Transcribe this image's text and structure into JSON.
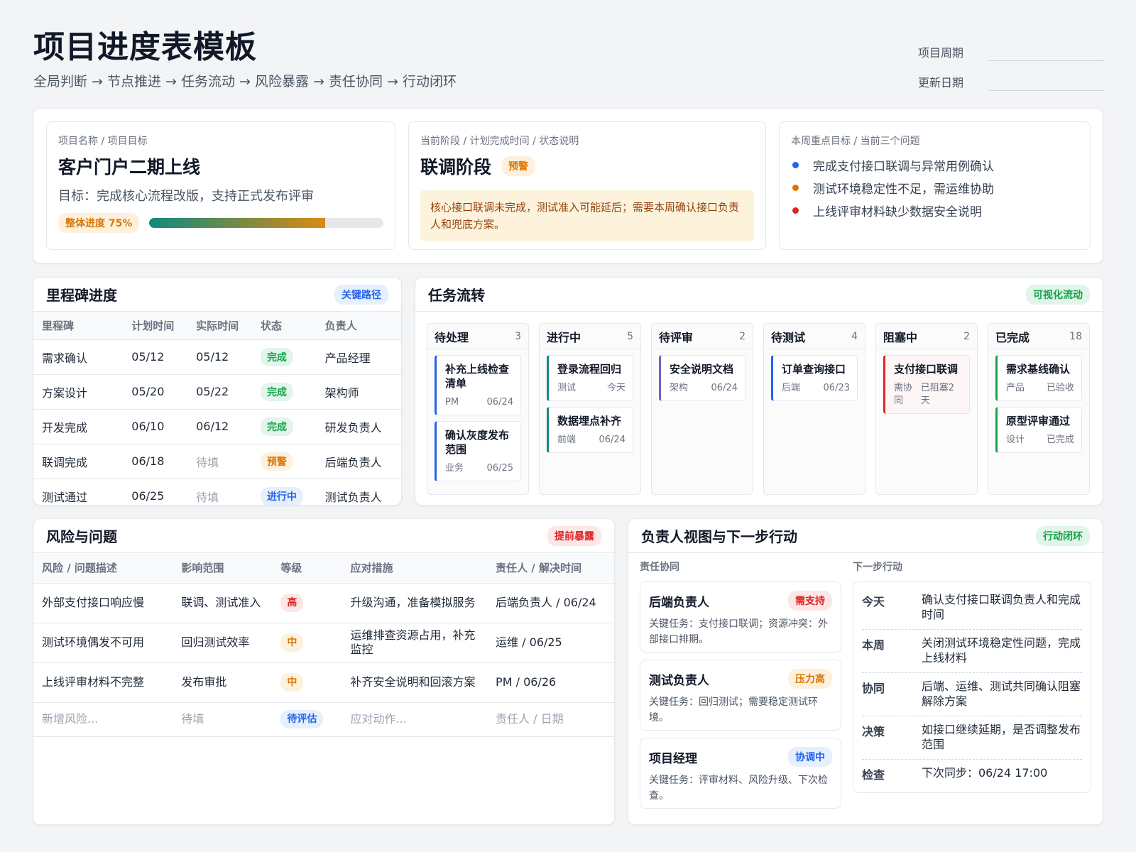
{
  "header": {
    "title": "项目进度表模板",
    "subtitle": "全局判断 → 节点推进 → 任务流动 → 风险暴露 → 责任协同 → 行动闭环",
    "cycle_label": "项目周期",
    "update_label": "更新日期"
  },
  "overview": {
    "project": {
      "label": "项目名称 / 项目目标",
      "name": "客户门户二期上线",
      "goal": "目标：完成核心流程改版，支持正式发布评审",
      "progress_label": "整体进度 75%",
      "progress_value": 0.75
    },
    "stage": {
      "label": "当前阶段 / 计划完成时间 / 状态说明",
      "name": "联调阶段",
      "badge": "预警",
      "note": "核心接口联调未完成，测试准入可能延后；需要本周确认接口负责人和兜底方案。"
    },
    "focus": {
      "label": "本周重点目标 / 当前三个问题",
      "items": [
        {
          "text": "完成支付接口联调与异常用例确认",
          "color": "#2563eb"
        },
        {
          "text": "测试环境稳定性不足，需运维协助",
          "color": "#d97706"
        },
        {
          "text": "上线评审材料缺少数据安全说明",
          "color": "#dc2626"
        }
      ]
    }
  },
  "milestones": {
    "title": "里程碑进度",
    "tag": "关键路径",
    "columns": [
      "里程碑",
      "计划时间",
      "实际时间",
      "状态",
      "负责人"
    ],
    "rows": [
      {
        "name": "需求确认",
        "plan": "05/12",
        "actual": "05/12",
        "status": "完成",
        "owner": "产品经理"
      },
      {
        "name": "方案设计",
        "plan": "05/20",
        "actual": "05/22",
        "status": "完成",
        "owner": "架构师"
      },
      {
        "name": "开发完成",
        "plan": "06/10",
        "actual": "06/12",
        "status": "完成",
        "owner": "研发负责人"
      },
      {
        "name": "联调完成",
        "plan": "06/18",
        "actual": "待填",
        "status": "预警",
        "owner": "后端负责人"
      },
      {
        "name": "测试通过",
        "plan": "06/25",
        "actual": "待填",
        "status": "进行中",
        "owner": "测试负责人"
      }
    ]
  },
  "tasks": {
    "title": "任务流转",
    "tag": "可视化流动",
    "columns": [
      {
        "name": "待处理",
        "count": "3",
        "color": "#2563eb",
        "cards": [
          {
            "title": "补充上线检查清单",
            "role": "PM",
            "date": "06/24"
          },
          {
            "title": "确认灰度发布范围",
            "role": "业务",
            "date": "06/25"
          }
        ]
      },
      {
        "name": "进行中",
        "count": "5",
        "color": "#0f8a7e",
        "cards": [
          {
            "title": "登录流程回归",
            "role": "测试",
            "date": "今天"
          },
          {
            "title": "数据埋点补齐",
            "role": "前端",
            "date": "06/24"
          }
        ]
      },
      {
        "name": "待评审",
        "count": "2",
        "color": "#7c5cc4",
        "cards": [
          {
            "title": "安全说明文档",
            "role": "架构",
            "date": "06/24"
          }
        ]
      },
      {
        "name": "待测试",
        "count": "4",
        "color": "#2563eb",
        "cards": [
          {
            "title": "订单查询接口",
            "role": "后端",
            "date": "06/23"
          }
        ]
      },
      {
        "name": "阻塞中",
        "count": "2",
        "color": "#dc2626",
        "cards": [
          {
            "title": "支付接口联调",
            "role": "需协同",
            "date": "已阻塞2天"
          }
        ]
      },
      {
        "name": "已完成",
        "count": "18",
        "color": "#16a34a",
        "cards": [
          {
            "title": "需求基线确认",
            "role": "产品",
            "date": "已验收"
          },
          {
            "title": "原型评审通过",
            "role": "设计",
            "date": "已完成"
          }
        ]
      }
    ]
  },
  "risks": {
    "title": "风险与问题",
    "tag": "提前暴露",
    "columns": [
      "风险 / 问题描述",
      "影响范围",
      "等级",
      "应对措施",
      "责任人 / 解决时间"
    ],
    "rows": [
      {
        "desc": "外部支付接口响应慢",
        "scope": "联调、测试准入",
        "level": "高",
        "action": "升级沟通，准备模拟服务",
        "owner": "后端负责人 / 06/24"
      },
      {
        "desc": "测试环境偶发不可用",
        "scope": "回归测试效率",
        "level": "中",
        "action": "运维排查资源占用，补充监控",
        "owner": "运维 / 06/25"
      },
      {
        "desc": "上线评审材料不完整",
        "scope": "发布审批",
        "level": "中",
        "action": "补齐安全说明和回滚方案",
        "owner": "PM / 06/26"
      }
    ],
    "placeholder": {
      "desc": "新增风险...",
      "scope": "待填",
      "level": "待评估",
      "action": "应对动作...",
      "owner": "责任人 / 日期"
    }
  },
  "owners": {
    "title": "负责人视图与下一步行动",
    "tag": "行动闭环",
    "collab_label": "责任协同",
    "next_label": "下一步行动",
    "people": [
      {
        "name": "后端负责人",
        "badge": "需支持",
        "task": "关键任务：支付接口联调；资源冲突：外部接口排期。"
      },
      {
        "name": "测试负责人",
        "badge": "压力高",
        "task": "关键任务：回归测试；需要稳定测试环境。"
      },
      {
        "name": "项目经理",
        "badge": "协调中",
        "task": "关键任务：评审材料、风险升级、下次检查。"
      }
    ],
    "actions": [
      {
        "key": "今天",
        "value": "确认支付接口联调负责人和完成时间"
      },
      {
        "key": "本周",
        "value": "关闭测试环境稳定性问题，完成上线材料"
      },
      {
        "key": "协同",
        "value": "后端、运维、测试共同确认阻塞解除方案"
      },
      {
        "key": "决策",
        "value": "如接口继续延期，是否调整发布范围"
      },
      {
        "key": "检查",
        "value": "下次同步：06/24 17:00"
      }
    ]
  }
}
